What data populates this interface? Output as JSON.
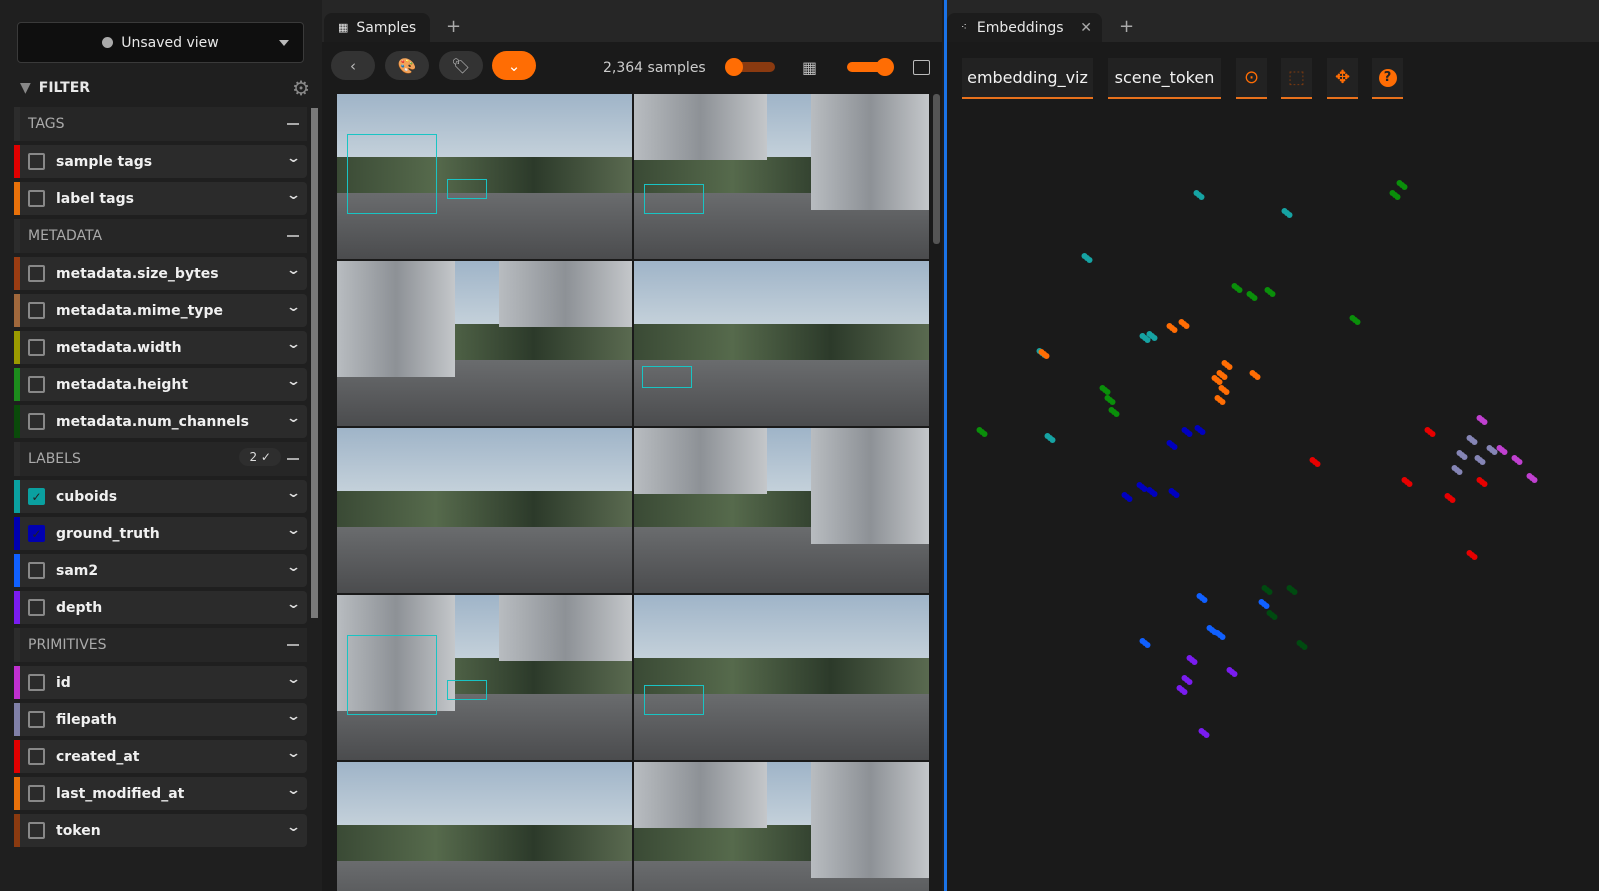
{
  "sidebar": {
    "view_label": "Unsaved view",
    "filter_label": "FILTER",
    "sections": [
      {
        "title": "TAGS",
        "items": [
          {
            "label": "sample tags",
            "color": "#e00000",
            "checked": false
          },
          {
            "label": "label tags",
            "color": "#e8710a",
            "checked": false
          }
        ]
      },
      {
        "title": "METADATA",
        "items": [
          {
            "label": "metadata.size_bytes",
            "color": "#9a3c12",
            "checked": false
          },
          {
            "label": "metadata.mime_type",
            "color": "#a0683c",
            "checked": false
          },
          {
            "label": "metadata.width",
            "color": "#9a9a00",
            "checked": false
          },
          {
            "label": "metadata.height",
            "color": "#1c8c1c",
            "checked": false
          },
          {
            "label": "metadata.num_channels",
            "color": "#0a4a0a",
            "checked": false
          }
        ]
      },
      {
        "title": "LABELS",
        "badge": "2 ✓",
        "items": [
          {
            "label": "cuboids",
            "color": "#0aa0a0",
            "checked": true
          },
          {
            "label": "ground_truth",
            "color": "#0000b0",
            "checked": true
          },
          {
            "label": "sam2",
            "color": "#1060ff",
            "checked": false
          },
          {
            "label": "depth",
            "color": "#7a1cf0",
            "checked": false
          }
        ]
      },
      {
        "title": "PRIMITIVES",
        "items": [
          {
            "label": "id",
            "color": "#c030d0",
            "checked": false
          },
          {
            "label": "filepath",
            "color": "#8080a8",
            "checked": false
          },
          {
            "label": "created_at",
            "color": "#e00000",
            "checked": false
          },
          {
            "label": "last_modified_at",
            "color": "#e8710a",
            "checked": false
          },
          {
            "label": "token",
            "color": "#8a3a10",
            "checked": false
          }
        ]
      }
    ]
  },
  "samples": {
    "tab_label": "Samples",
    "count_label": "2,364 samples"
  },
  "embeddings": {
    "tab_label": "Embeddings",
    "brain_key": "embedding_viz",
    "color_by": "scene_token"
  },
  "chart_data": {
    "type": "scatter",
    "title": "",
    "xlabel": "",
    "ylabel": "",
    "xlim": [
      0,
      620
    ],
    "ylim": [
      0,
      770
    ],
    "series": [
      {
        "name": "teal",
        "color": "#16a3a3",
        "points": [
          [
            249,
            95
          ],
          [
            337,
            113
          ],
          [
            137,
            158
          ],
          [
            92,
            253
          ],
          [
            100,
            338
          ],
          [
            202,
            236
          ],
          [
            195,
            238
          ]
        ]
      },
      {
        "name": "green",
        "color": "#0a8f0a",
        "points": [
          [
            452,
            85
          ],
          [
            445,
            95
          ],
          [
            287,
            188
          ],
          [
            302,
            196
          ],
          [
            320,
            192
          ],
          [
            405,
            220
          ],
          [
            155,
            290
          ],
          [
            160,
            300
          ],
          [
            164,
            312
          ],
          [
            32,
            332
          ]
        ]
      },
      {
        "name": "orange",
        "color": "#ff6d04",
        "points": [
          [
            222,
            228
          ],
          [
            234,
            224
          ],
          [
            272,
            275
          ],
          [
            277,
            265
          ],
          [
            267,
            280
          ],
          [
            274,
            290
          ],
          [
            270,
            300
          ],
          [
            305,
            275
          ],
          [
            94,
            254
          ]
        ]
      },
      {
        "name": "navy",
        "color": "#0000c0",
        "points": [
          [
            222,
            345
          ],
          [
            237,
            332
          ],
          [
            250,
            330
          ],
          [
            177,
            397
          ],
          [
            192,
            387
          ],
          [
            202,
            392
          ],
          [
            224,
            393
          ]
        ]
      },
      {
        "name": "red",
        "color": "#e80000",
        "points": [
          [
            365,
            362
          ],
          [
            480,
            332
          ],
          [
            457,
            382
          ],
          [
            500,
            398
          ],
          [
            522,
            455
          ],
          [
            532,
            382
          ]
        ]
      },
      {
        "name": "lavender",
        "color": "#8585b5",
        "points": [
          [
            512,
            355
          ],
          [
            522,
            340
          ],
          [
            530,
            360
          ],
          [
            507,
            370
          ],
          [
            542,
            350
          ]
        ]
      },
      {
        "name": "magenta",
        "color": "#c040d0",
        "points": [
          [
            532,
            320
          ],
          [
            552,
            350
          ],
          [
            567,
            360
          ],
          [
            582,
            378
          ]
        ]
      },
      {
        "name": "blue",
        "color": "#1060ff",
        "points": [
          [
            252,
            498
          ],
          [
            262,
            530
          ],
          [
            270,
            535
          ],
          [
            195,
            543
          ],
          [
            314,
            504
          ]
        ]
      },
      {
        "name": "purple",
        "color": "#7a1cf0",
        "points": [
          [
            242,
            560
          ],
          [
            237,
            580
          ],
          [
            232,
            590
          ],
          [
            282,
            572
          ],
          [
            254,
            633
          ]
        ]
      },
      {
        "name": "darkgreen",
        "color": "#004a10",
        "points": [
          [
            317,
            490
          ],
          [
            322,
            515
          ],
          [
            342,
            490
          ],
          [
            352,
            545
          ]
        ]
      }
    ]
  }
}
